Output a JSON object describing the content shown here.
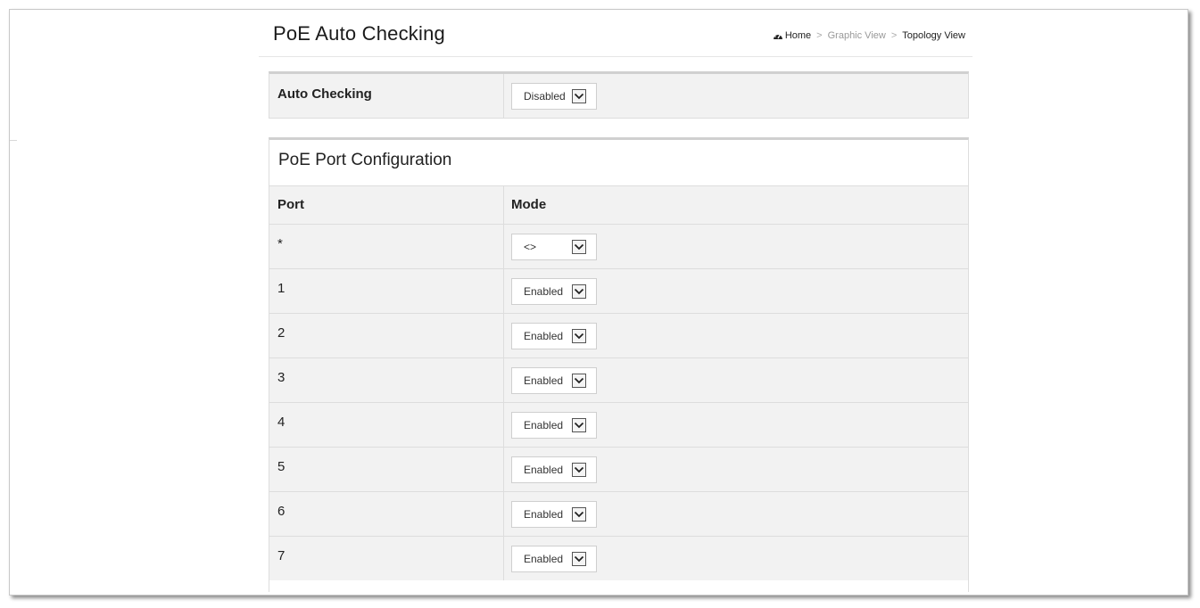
{
  "header": {
    "title": "PoE Auto Checking",
    "breadcrumb": {
      "home": "Home",
      "separator": ">",
      "graphic_view": "Graphic View",
      "topology_view": "Topology View"
    }
  },
  "auto_checking": {
    "label": "Auto Checking",
    "value": "Disabled"
  },
  "port_config": {
    "title": "PoE Port Configuration",
    "columns": {
      "port": "Port",
      "mode": "Mode"
    },
    "rows": [
      {
        "port": "*",
        "mode": "<>"
      },
      {
        "port": "1",
        "mode": "Enabled"
      },
      {
        "port": "2",
        "mode": "Enabled"
      },
      {
        "port": "3",
        "mode": "Enabled"
      },
      {
        "port": "4",
        "mode": "Enabled"
      },
      {
        "port": "5",
        "mode": "Enabled"
      },
      {
        "port": "6",
        "mode": "Enabled"
      },
      {
        "port": "7",
        "mode": "Enabled"
      }
    ]
  },
  "colors": {
    "panel_bg": "#f2f2f2",
    "border": "#dddddd",
    "text": "#222222",
    "breadcrumb_muted": "#999999"
  },
  "icons": {
    "home": "dashboard-icon",
    "dropdown": "chevron-down-icon"
  }
}
